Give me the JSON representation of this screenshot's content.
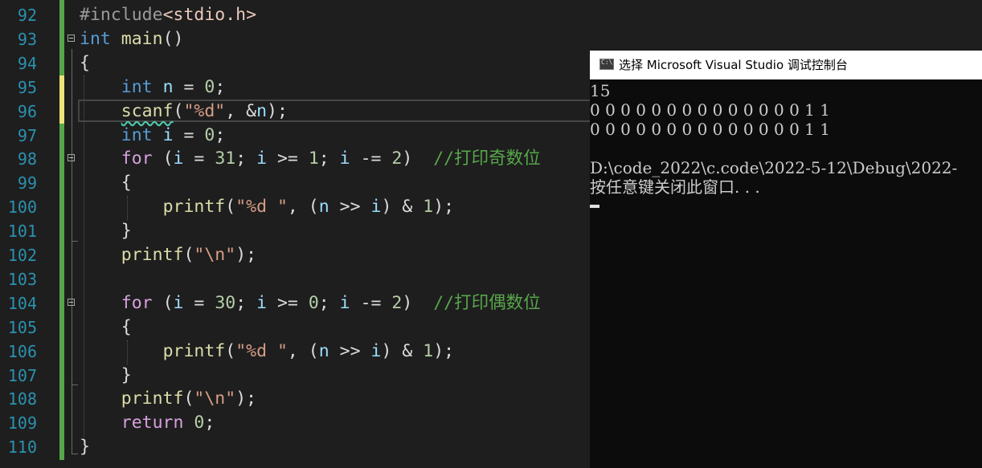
{
  "editor": {
    "lines": [
      {
        "n": "92",
        "t": [
          [
            "#include",
            "pp"
          ],
          [
            "<stdio.h>",
            "hdr"
          ]
        ]
      },
      {
        "n": "93",
        "t": [
          [
            "int",
            "kw"
          ],
          [
            " ",
            ""
          ],
          [
            "main",
            "fn"
          ],
          [
            "()",
            ""
          ]
        ]
      },
      {
        "n": "94",
        "t": [
          [
            "{",
            ""
          ]
        ]
      },
      {
        "n": "95",
        "t": [
          [
            "    ",
            ""
          ],
          [
            "int",
            "kw"
          ],
          [
            " ",
            ""
          ],
          [
            "n",
            "var"
          ],
          [
            " = ",
            ""
          ],
          [
            "0",
            "num"
          ],
          [
            ";",
            ""
          ]
        ]
      },
      {
        "n": "96",
        "t": [
          [
            "    ",
            ""
          ],
          [
            "scanf",
            "fn squig"
          ],
          [
            "(",
            ""
          ],
          [
            "\"%d\"",
            "str"
          ],
          [
            ", &",
            ""
          ],
          [
            "n",
            "var"
          ],
          [
            ");",
            ""
          ]
        ]
      },
      {
        "n": "97",
        "t": [
          [
            "    ",
            ""
          ],
          [
            "int",
            "kw"
          ],
          [
            " ",
            ""
          ],
          [
            "i",
            "var"
          ],
          [
            " = ",
            ""
          ],
          [
            "0",
            "num"
          ],
          [
            ";",
            ""
          ]
        ]
      },
      {
        "n": "98",
        "t": [
          [
            "    ",
            ""
          ],
          [
            "for",
            "ctl"
          ],
          [
            " (",
            ""
          ],
          [
            "i",
            "var"
          ],
          [
            " = ",
            ""
          ],
          [
            "31",
            "num"
          ],
          [
            "; ",
            ""
          ],
          [
            "i",
            "var"
          ],
          [
            " >= ",
            ""
          ],
          [
            "1",
            "num"
          ],
          [
            "; ",
            ""
          ],
          [
            "i",
            "var"
          ],
          [
            " -= ",
            ""
          ],
          [
            "2",
            "num"
          ],
          [
            ")  ",
            ""
          ],
          [
            "//打印奇数位",
            "cmt"
          ]
        ]
      },
      {
        "n": "99",
        "t": [
          [
            "    {",
            ""
          ]
        ]
      },
      {
        "n": "100",
        "t": [
          [
            "        ",
            ""
          ],
          [
            "printf",
            "fn"
          ],
          [
            "(",
            ""
          ],
          [
            "\"%d \"",
            "str"
          ],
          [
            ", (",
            ""
          ],
          [
            "n",
            "var"
          ],
          [
            " >> ",
            ""
          ],
          [
            "i",
            "var"
          ],
          [
            ") & ",
            ""
          ],
          [
            "1",
            "num"
          ],
          [
            ");",
            ""
          ]
        ]
      },
      {
        "n": "101",
        "t": [
          [
            "    }",
            ""
          ]
        ]
      },
      {
        "n": "102",
        "t": [
          [
            "    ",
            ""
          ],
          [
            "printf",
            "fn"
          ],
          [
            "(",
            ""
          ],
          [
            "\"\\n\"",
            "str"
          ],
          [
            ");",
            ""
          ]
        ]
      },
      {
        "n": "103",
        "t": []
      },
      {
        "n": "104",
        "t": [
          [
            "    ",
            ""
          ],
          [
            "for",
            "ctl"
          ],
          [
            " (",
            ""
          ],
          [
            "i",
            "var"
          ],
          [
            " = ",
            ""
          ],
          [
            "30",
            "num"
          ],
          [
            "; ",
            ""
          ],
          [
            "i",
            "var"
          ],
          [
            " >= ",
            ""
          ],
          [
            "0",
            "num"
          ],
          [
            "; ",
            ""
          ],
          [
            "i",
            "var"
          ],
          [
            " -= ",
            ""
          ],
          [
            "2",
            "num"
          ],
          [
            ")  ",
            ""
          ],
          [
            "//打印偶数位",
            "cmt"
          ]
        ]
      },
      {
        "n": "105",
        "t": [
          [
            "    {",
            ""
          ]
        ]
      },
      {
        "n": "106",
        "t": [
          [
            "        ",
            ""
          ],
          [
            "printf",
            "fn"
          ],
          [
            "(",
            ""
          ],
          [
            "\"%d \"",
            "str"
          ],
          [
            ", (",
            ""
          ],
          [
            "n",
            "var"
          ],
          [
            " >> ",
            ""
          ],
          [
            "i",
            "var"
          ],
          [
            ") & ",
            ""
          ],
          [
            "1",
            "num"
          ],
          [
            ");",
            ""
          ]
        ]
      },
      {
        "n": "107",
        "t": [
          [
            "    }",
            ""
          ]
        ]
      },
      {
        "n": "108",
        "t": [
          [
            "    ",
            ""
          ],
          [
            "printf",
            "fn"
          ],
          [
            "(",
            ""
          ],
          [
            "\"\\n\"",
            "str"
          ],
          [
            ");",
            ""
          ]
        ]
      },
      {
        "n": "109",
        "t": [
          [
            "    ",
            ""
          ],
          [
            "return",
            "ctl"
          ],
          [
            " ",
            ""
          ],
          [
            "0",
            "num"
          ],
          [
            ";",
            ""
          ]
        ]
      },
      {
        "n": "110",
        "t": [
          [
            "}",
            ""
          ]
        ]
      }
    ],
    "fold_lines": [
      "93",
      "98",
      "104"
    ]
  },
  "console": {
    "title": "选择 Microsoft Visual Studio 调试控制台",
    "icon": "console-app-icon",
    "lines": [
      "15",
      "0 0 0 0 0 0 0 0 0 0 0 0 0 0 1 1",
      "0 0 0 0 0 0 0 0 0 0 0 0 0 0 1 1",
      "",
      "D:\\code_2022\\c.code\\2022-5-12\\Debug\\2022-",
      "按任意键关闭此窗口. . ."
    ]
  },
  "colors": {
    "editor_bg": "#1e1e1e",
    "line_number": "#2b91af",
    "keyword": "#569cd6",
    "control": "#d8a0df",
    "function": "#dcdcaa",
    "variable": "#9cdcfe",
    "number": "#b5cea8",
    "string": "#d69d85",
    "comment": "#57a64a",
    "console_bg": "#0c0c0c"
  }
}
